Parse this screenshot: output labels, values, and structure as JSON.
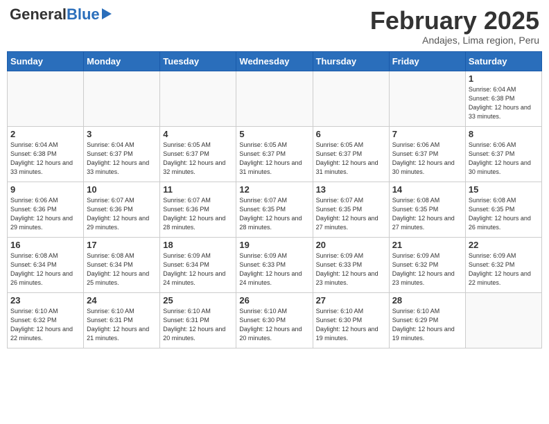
{
  "logo": {
    "general": "General",
    "blue": "Blue"
  },
  "header": {
    "month": "February 2025",
    "location": "Andajes, Lima region, Peru"
  },
  "weekdays": [
    "Sunday",
    "Monday",
    "Tuesday",
    "Wednesday",
    "Thursday",
    "Friday",
    "Saturday"
  ],
  "weeks": [
    [
      {
        "day": "",
        "info": ""
      },
      {
        "day": "",
        "info": ""
      },
      {
        "day": "",
        "info": ""
      },
      {
        "day": "",
        "info": ""
      },
      {
        "day": "",
        "info": ""
      },
      {
        "day": "",
        "info": ""
      },
      {
        "day": "1",
        "info": "Sunrise: 6:04 AM\nSunset: 6:38 PM\nDaylight: 12 hours\nand 33 minutes."
      }
    ],
    [
      {
        "day": "2",
        "info": "Sunrise: 6:04 AM\nSunset: 6:38 PM\nDaylight: 12 hours\nand 33 minutes."
      },
      {
        "day": "3",
        "info": "Sunrise: 6:04 AM\nSunset: 6:37 PM\nDaylight: 12 hours\nand 33 minutes."
      },
      {
        "day": "4",
        "info": "Sunrise: 6:05 AM\nSunset: 6:37 PM\nDaylight: 12 hours\nand 32 minutes."
      },
      {
        "day": "5",
        "info": "Sunrise: 6:05 AM\nSunset: 6:37 PM\nDaylight: 12 hours\nand 31 minutes."
      },
      {
        "day": "6",
        "info": "Sunrise: 6:05 AM\nSunset: 6:37 PM\nDaylight: 12 hours\nand 31 minutes."
      },
      {
        "day": "7",
        "info": "Sunrise: 6:06 AM\nSunset: 6:37 PM\nDaylight: 12 hours\nand 30 minutes."
      },
      {
        "day": "8",
        "info": "Sunrise: 6:06 AM\nSunset: 6:37 PM\nDaylight: 12 hours\nand 30 minutes."
      }
    ],
    [
      {
        "day": "9",
        "info": "Sunrise: 6:06 AM\nSunset: 6:36 PM\nDaylight: 12 hours\nand 29 minutes."
      },
      {
        "day": "10",
        "info": "Sunrise: 6:07 AM\nSunset: 6:36 PM\nDaylight: 12 hours\nand 29 minutes."
      },
      {
        "day": "11",
        "info": "Sunrise: 6:07 AM\nSunset: 6:36 PM\nDaylight: 12 hours\nand 28 minutes."
      },
      {
        "day": "12",
        "info": "Sunrise: 6:07 AM\nSunset: 6:35 PM\nDaylight: 12 hours\nand 28 minutes."
      },
      {
        "day": "13",
        "info": "Sunrise: 6:07 AM\nSunset: 6:35 PM\nDaylight: 12 hours\nand 27 minutes."
      },
      {
        "day": "14",
        "info": "Sunrise: 6:08 AM\nSunset: 6:35 PM\nDaylight: 12 hours\nand 27 minutes."
      },
      {
        "day": "15",
        "info": "Sunrise: 6:08 AM\nSunset: 6:35 PM\nDaylight: 12 hours\nand 26 minutes."
      }
    ],
    [
      {
        "day": "16",
        "info": "Sunrise: 6:08 AM\nSunset: 6:34 PM\nDaylight: 12 hours\nand 26 minutes."
      },
      {
        "day": "17",
        "info": "Sunrise: 6:08 AM\nSunset: 6:34 PM\nDaylight: 12 hours\nand 25 minutes."
      },
      {
        "day": "18",
        "info": "Sunrise: 6:09 AM\nSunset: 6:34 PM\nDaylight: 12 hours\nand 24 minutes."
      },
      {
        "day": "19",
        "info": "Sunrise: 6:09 AM\nSunset: 6:33 PM\nDaylight: 12 hours\nand 24 minutes."
      },
      {
        "day": "20",
        "info": "Sunrise: 6:09 AM\nSunset: 6:33 PM\nDaylight: 12 hours\nand 23 minutes."
      },
      {
        "day": "21",
        "info": "Sunrise: 6:09 AM\nSunset: 6:32 PM\nDaylight: 12 hours\nand 23 minutes."
      },
      {
        "day": "22",
        "info": "Sunrise: 6:09 AM\nSunset: 6:32 PM\nDaylight: 12 hours\nand 22 minutes."
      }
    ],
    [
      {
        "day": "23",
        "info": "Sunrise: 6:10 AM\nSunset: 6:32 PM\nDaylight: 12 hours\nand 22 minutes."
      },
      {
        "day": "24",
        "info": "Sunrise: 6:10 AM\nSunset: 6:31 PM\nDaylight: 12 hours\nand 21 minutes."
      },
      {
        "day": "25",
        "info": "Sunrise: 6:10 AM\nSunset: 6:31 PM\nDaylight: 12 hours\nand 20 minutes."
      },
      {
        "day": "26",
        "info": "Sunrise: 6:10 AM\nSunset: 6:30 PM\nDaylight: 12 hours\nand 20 minutes."
      },
      {
        "day": "27",
        "info": "Sunrise: 6:10 AM\nSunset: 6:30 PM\nDaylight: 12 hours\nand 19 minutes."
      },
      {
        "day": "28",
        "info": "Sunrise: 6:10 AM\nSunset: 6:29 PM\nDaylight: 12 hours\nand 19 minutes."
      },
      {
        "day": "",
        "info": ""
      }
    ]
  ]
}
